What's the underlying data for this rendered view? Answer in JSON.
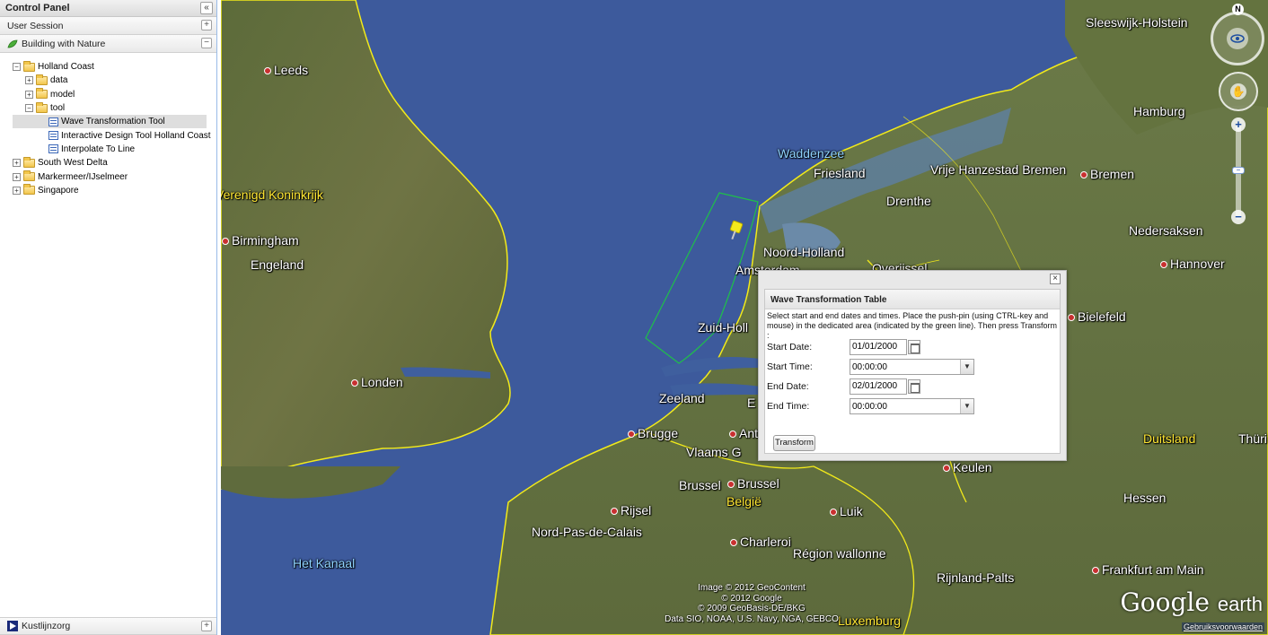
{
  "panel": {
    "title": "Control Panel",
    "collapse_glyph": "«",
    "sections": [
      {
        "label": "User Session",
        "toggle": "+"
      },
      {
        "label": "Building with Nature",
        "toggle": "−"
      }
    ],
    "tree": [
      {
        "label": "Holland Coast",
        "exp": "−"
      },
      {
        "label": "data",
        "exp": "+"
      },
      {
        "label": "model",
        "exp": "+"
      },
      {
        "label": "tool",
        "exp": "−"
      },
      {
        "label": "Wave Transformation Tool"
      },
      {
        "label": "Interactive Design Tool Holland Coast"
      },
      {
        "label": "Interpolate To Line"
      },
      {
        "label": "South West Delta",
        "exp": "+"
      },
      {
        "label": "Markermeer/IJselmeer",
        "exp": "+"
      },
      {
        "label": "Singapore",
        "exp": "+"
      }
    ],
    "bottom_section": {
      "label": "Kustlijnzorg",
      "toggle": "+"
    }
  },
  "map": {
    "labels": {
      "leeds": "Leeds",
      "verenigd": "Verenigd Koninkrijk",
      "birmingham": "Birmingham",
      "engeland": "Engeland",
      "londen": "Londen",
      "kanaal": "Het Kanaal",
      "waddenzee": "Waddenzee",
      "friesland": "Friesland",
      "drenthe": "Drenthe",
      "noord_holland": "Noord-Holland",
      "amsterdam": "Amsterdam",
      "overijssel": "Overijssel",
      "zuid_holland": "Zuid-Holl",
      "zeeland": "Zeeland",
      "e": "E",
      "brugge": "Brugge",
      "ant": "Ant",
      "vlaams": "Vlaams G",
      "brussel1": "Brussel",
      "brussel2": "Brussel",
      "belgie": "België",
      "rijsel": "Rijsel",
      "nord_pas": "Nord-Pas-de-Calais",
      "charleroi": "Charleroi",
      "luik": "Luik",
      "region_wallonne": "Région wallonne",
      "keulen": "Keulen",
      "sleeswijk": "Sleeswijk-Holstein",
      "hamburg": "Hamburg",
      "vrije_hanzestad": "Vrije Hanzestad Bremen",
      "bremen": "Bremen",
      "nedersaksen": "Nedersaksen",
      "hannover": "Hannover",
      "bielefeld": "Bielefeld",
      "duitsland": "Duitsland",
      "thuri": "Thüri",
      "hessen": "Hessen",
      "rijnland": "Rijnland-Palts",
      "frankfurt": "Frankfurt am Main",
      "luxemburg": "Luxemburg"
    },
    "copyright": [
      "Image © 2012 GeoContent",
      "© 2012 Google",
      "© 2009 GeoBasis-DE/BKG",
      "Data SIO, NOAA, U.S. Navy, NGA, GEBCO"
    ],
    "logo_main": "Google",
    "logo_sub": "earth",
    "terms": "Gebruiksvoorwaarden",
    "north": "N",
    "zoom_in": "+",
    "zoom_out": "−",
    "colors": {
      "sea": "#3d5a9c",
      "border": "#f2ea1a",
      "area": "#1fbf4a"
    }
  },
  "dialog": {
    "title": "Wave Transformation Table",
    "close": "×",
    "description": "Select start and end dates and times. Place the push-pin (using CTRL-key and mouse) in the dedicated area (indicated by the green line). Then press Transform :",
    "start_date_label": "Start Date:",
    "start_date": "01/01/2000",
    "start_time_label": "Start Time:",
    "start_time": "00:00:00",
    "end_date_label": "End Date:",
    "end_date": "02/01/2000",
    "end_time_label": "End Time:",
    "end_time": "00:00:00",
    "transform_label": "Transform"
  }
}
